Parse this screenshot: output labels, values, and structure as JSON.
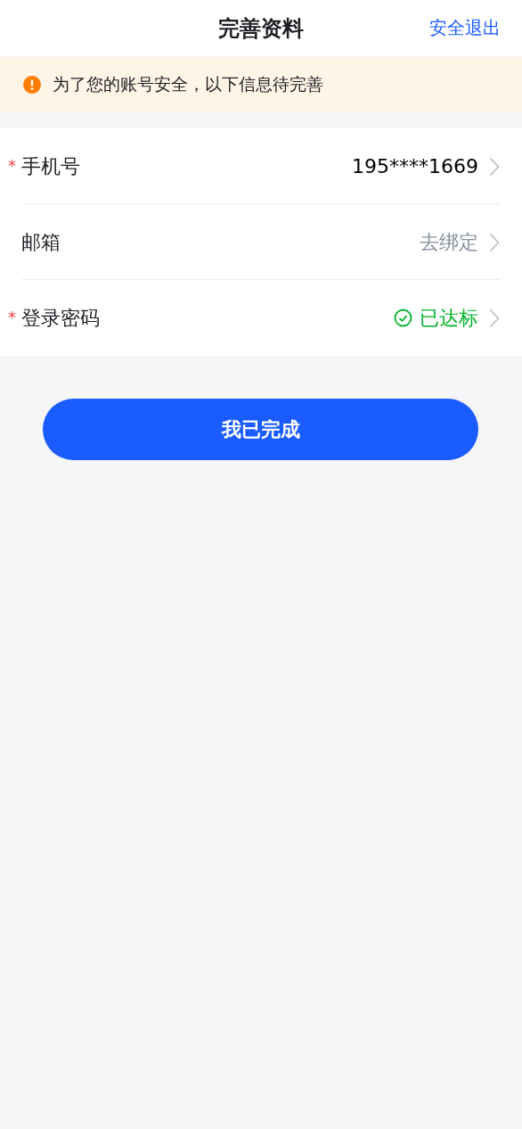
{
  "header": {
    "title": "完善资料",
    "action": "安全退出"
  },
  "notice": {
    "text": "为了您的账号安全，以下信息待完善"
  },
  "required_mark": "*",
  "rows": [
    {
      "label": "手机号",
      "required": true,
      "kind": "plain",
      "value": "195****1669"
    },
    {
      "label": "邮箱",
      "required": false,
      "kind": "action",
      "value": "去绑定"
    },
    {
      "label": "登录密码",
      "required": true,
      "kind": "done",
      "value": "已达标"
    }
  ],
  "button": {
    "label": "我已完成"
  }
}
